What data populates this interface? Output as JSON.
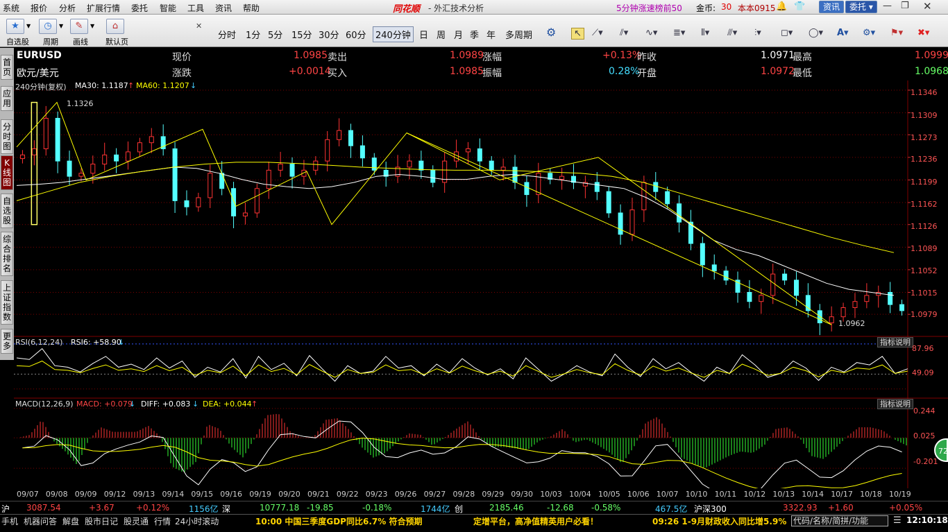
{
  "menu": [
    "系统",
    "报价",
    "分析",
    "扩展行情",
    "委托",
    "智能",
    "工具",
    "资讯",
    "帮助"
  ],
  "brand": "同花顺",
  "app_title": "- 外汇技术分析",
  "promo": "5分钟涨速榜前50",
  "coin_label": "金币:",
  "coin_value": "30",
  "version": "本本0915",
  "top_buttons": {
    "news": "资讯",
    "trade": "委托"
  },
  "toolbar": {
    "watchlist": "自选股",
    "period": "周期",
    "draw": "画线",
    "home": "默认页"
  },
  "periods": [
    "分时",
    "1分",
    "5分",
    "15分",
    "30分",
    "60分",
    "240分钟",
    "日",
    "周",
    "月",
    "季",
    "年",
    "多周期"
  ],
  "side_tabs": [
    "首页",
    "应用",
    "分时图",
    "K线图",
    "自选股",
    "综合排名",
    "上证指数",
    "更多"
  ],
  "quote": {
    "symbol": "EURUSD",
    "name": "欧元/美元",
    "labels": [
      "现价",
      "涨跌",
      "卖出",
      "买入",
      "涨幅",
      "振幅",
      "昨收",
      "开盘",
      "最高",
      "最低"
    ],
    "price": "1.0985",
    "change": "+0.0014",
    "sell": "1.0989",
    "buy": "1.0985",
    "change_pct": "+0.13%",
    "amplitude": "0.28%",
    "prev_close": "1.0971",
    "open": "1.0972",
    "high": "1.0999",
    "low": "1.0968"
  },
  "main_panel": {
    "label": "240分钟(复权)",
    "ma30": "MA30: 1.1187",
    "ma60": "MA60: 1.1207",
    "hi_mark": "1.1326",
    "lo_mark": "1.0962"
  },
  "rsi_panel": {
    "label": "RSI(6,12,24)",
    "rsi6": "RSI6: +58.90",
    "levels": [
      "87.96",
      "49.09"
    ]
  },
  "macd_panel": {
    "label": "MACD(12,26,9)",
    "macd": "MACD: +0.079",
    "diff": "DIFF: +0.083",
    "dea": "DEA: +0.044",
    "levels": [
      "0.244",
      "0.025",
      "-0.201"
    ]
  },
  "indicator_button": "指标说明",
  "badge": "72",
  "colors": {
    "up": "#ff3333",
    "down": "#54ffff",
    "ma30": "#ffffff",
    "ma60": "#ffff00",
    "grid": "#800000"
  },
  "status1": [
    {
      "t": "沪",
      "c": "#fff"
    },
    {
      "t": "3087.54",
      "c": "#ff4444"
    },
    {
      "t": "+3.67",
      "c": "#ff4444"
    },
    {
      "t": "+0.12%",
      "c": "#ff4444"
    },
    {
      "t": "1156亿",
      "c": "#44ccff"
    },
    {
      "t": "深",
      "c": "#fff"
    },
    {
      "t": "10777.18",
      "c": "#66ff66"
    },
    {
      "t": "-19.85",
      "c": "#66ff66"
    },
    {
      "t": "-0.18%",
      "c": "#66ff66"
    },
    {
      "t": "1744亿",
      "c": "#44ccff"
    },
    {
      "t": "创",
      "c": "#fff"
    },
    {
      "t": "2185.46",
      "c": "#66ff66"
    },
    {
      "t": "-12.68",
      "c": "#66ff66"
    },
    {
      "t": "-0.58%",
      "c": "#66ff66"
    },
    {
      "t": "467.5亿",
      "c": "#44ccff"
    },
    {
      "t": "沪深300",
      "c": "#fff"
    },
    {
      "t": "3322.93",
      "c": "#ff4444"
    },
    {
      "t": "+1.60",
      "c": "#ff4444"
    },
    {
      "t": "+0.05%",
      "c": "#ff4444"
    }
  ],
  "status2": {
    "tabs": [
      "手机",
      "机器问答",
      "解盘",
      "股市日记",
      "股灵通",
      "行情",
      "24小时滚动"
    ],
    "ticker1": "10:00 中国三季度GDP同比6.7% 符合预期",
    "ticker2": "定增平台，高净值精英用户必看！",
    "ticker3": "09:26 1-9月财政收入同比增5.9%",
    "cmd": "代码/名称/简拼/功能",
    "clock": "12:10:18"
  },
  "chart_data": {
    "type": "candlestick",
    "x_dates": [
      "09/07",
      "09/08",
      "09/09",
      "09/12",
      "09/13",
      "09/14",
      "09/15",
      "09/16",
      "09/19",
      "09/20",
      "09/21",
      "09/22",
      "09/23",
      "09/26",
      "09/27",
      "09/28",
      "09/29",
      "09/30",
      "10/03",
      "10/04",
      "10/05",
      "10/06",
      "10/07",
      "10/10",
      "10/11",
      "10/12",
      "10/13",
      "10/14",
      "10/17",
      "10/18",
      "10/19"
    ],
    "y_ticks": [
      1.1346,
      1.1309,
      1.1273,
      1.1236,
      1.1199,
      1.1162,
      1.1126,
      1.1089,
      1.1052,
      1.1015,
      1.0979
    ],
    "ylim": [
      1.0944,
      1.1346
    ],
    "close_path": [
      1.124,
      1.125,
      1.13,
      1.123,
      1.1205,
      1.121,
      1.1225,
      1.124,
      1.123,
      1.1245,
      1.126,
      1.127,
      1.125,
      1.1165,
      1.1155,
      1.117,
      1.121,
      1.1185,
      1.114,
      1.1145,
      1.1185,
      1.1215,
      1.1225,
      1.1205,
      1.1215,
      1.123,
      1.1265,
      1.128,
      1.1255,
      1.1235,
      1.1215,
      1.1205,
      1.122,
      1.123,
      1.1215,
      1.1195,
      1.123,
      1.1245,
      1.125,
      1.123,
      1.1215,
      1.122,
      1.1195,
      1.1175,
      1.121,
      1.12,
      1.1205,
      1.1195,
      1.1195,
      1.118,
      1.1145,
      1.111,
      1.115,
      1.1195,
      1.118,
      1.116,
      1.113,
      1.1095,
      1.106,
      1.105,
      1.1035,
      1.1015,
      1.1,
      1.101,
      1.1045,
      1.1035,
      1.101,
      1.0985,
      1.0965,
      1.0975,
      1.099,
      1.1,
      1.101,
      1.1015,
      1.0995,
      1.0985
    ],
    "ma30": [
      1.119,
      1.1192,
      1.1195,
      1.12,
      1.1205,
      1.121,
      1.1215,
      1.122,
      1.1218,
      1.121,
      1.12,
      1.1192,
      1.1188,
      1.1185,
      1.1188,
      1.1195,
      1.1205,
      1.1208,
      1.1205,
      1.12,
      1.12,
      1.1205,
      1.1208,
      1.1205,
      1.12,
      1.1195,
      1.119,
      1.1185,
      1.117,
      1.115,
      1.1125,
      1.11,
      1.1085,
      1.1075,
      1.106,
      1.1045,
      1.103,
      1.102,
      1.1015,
      1.101
    ],
    "ma60": [
      1.1165,
      1.118,
      1.1195,
      1.1205,
      1.1213,
      1.122,
      1.1225,
      1.1228,
      1.1228,
      1.1226,
      1.1223,
      1.122,
      1.1218,
      1.1216,
      1.1215,
      1.1215,
      1.1214,
      1.1212,
      1.121,
      1.1205,
      1.1195,
      1.118,
      1.1165,
      1.115,
      1.1135,
      1.112,
      1.1105,
      1.1092,
      1.108
    ],
    "zigzag": [
      1.1253,
      1.1326,
      1.1199,
      1.1282,
      1.1156,
      1.1213,
      1.1126,
      1.1276,
      1.1199,
      1.1236,
      1.0962
    ],
    "trendline": [
      1.1276,
      1.0962
    ],
    "rsi6": [
      70,
      68,
      82,
      60,
      58,
      52,
      63,
      72,
      58,
      62,
      55,
      70,
      57,
      66,
      45,
      58,
      52,
      69,
      44,
      72,
      55,
      63,
      47,
      73,
      56,
      40,
      60,
      50,
      53,
      72,
      57,
      60,
      47,
      62,
      51,
      69,
      57,
      48,
      56,
      43,
      70,
      55,
      40,
      49,
      60,
      52,
      47,
      75,
      58,
      46,
      69,
      56,
      64,
      51,
      40,
      58,
      50,
      74,
      61,
      45,
      50,
      66,
      57,
      41,
      58,
      52,
      64,
      61,
      72,
      50,
      56
    ],
    "rsi_levels": [
      87.96,
      49.09
    ],
    "macd_levels": [
      0.244,
      0.025,
      -0.201
    ]
  }
}
